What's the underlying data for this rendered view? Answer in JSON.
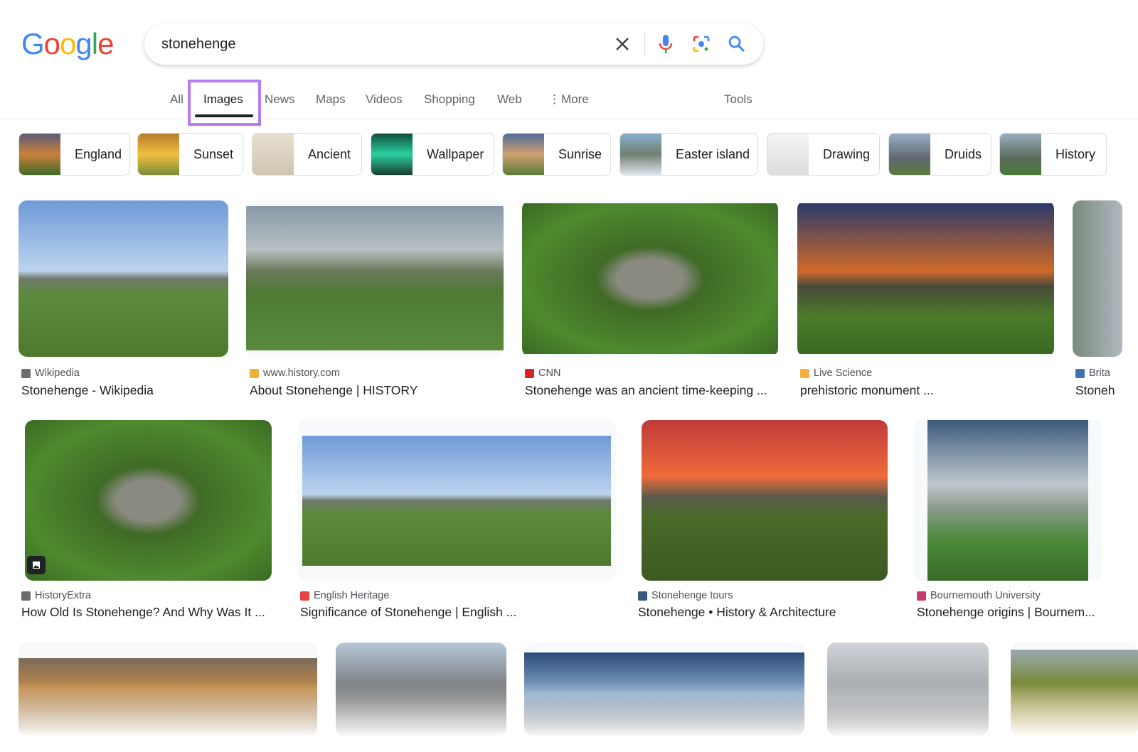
{
  "logo": {
    "letters": [
      "G",
      "o",
      "o",
      "g",
      "l",
      "e"
    ],
    "colors": [
      "#4285f4",
      "#ea4335",
      "#fbbc05",
      "#4285f4",
      "#34a853",
      "#ea4335"
    ]
  },
  "search": {
    "query": "stonehenge",
    "icons": [
      "close-icon",
      "microphone-icon",
      "lens-icon",
      "search-icon"
    ]
  },
  "tabs": {
    "items": [
      "All",
      "Images",
      "News",
      "Maps",
      "Videos",
      "Shopping",
      "Web",
      "More"
    ],
    "active": "Images",
    "tools": "Tools"
  },
  "highlight_color": "#b57cf2",
  "chips": [
    "England",
    "Sunset",
    "Ancient",
    "Wallpaper",
    "Sunrise",
    "Easter island",
    "Drawing",
    "Druids",
    "History"
  ],
  "results_row1": [
    {
      "source": "Wikipedia",
      "title": "Stonehenge - Wikipedia",
      "favicon": "W"
    },
    {
      "source": "www.history.com",
      "title": "About Stonehenge | HISTORY",
      "favicon": "H"
    },
    {
      "source": "CNN",
      "title": "Stonehenge was an ancient time-keeping ...",
      "favicon": "CNN"
    },
    {
      "source": "Live Science",
      "title": "prehistoric monument ...",
      "favicon": "LS"
    },
    {
      "source": "Brita",
      "title": "Stoneh",
      "favicon": "B"
    }
  ],
  "results_row2": [
    {
      "source": "HistoryExtra",
      "title": "How Old Is Stonehenge? And Why Was It ...",
      "favicon": "H"
    },
    {
      "source": "English Heritage",
      "title": "Significance of Stonehenge | English ...",
      "favicon": "#"
    },
    {
      "source": "Stonehenge tours",
      "title": "Stonehenge • History & Architecture",
      "favicon": "ST"
    },
    {
      "source": "Bournemouth University",
      "title": "Stonehenge origins | Bournem...",
      "favicon": "BU"
    }
  ]
}
